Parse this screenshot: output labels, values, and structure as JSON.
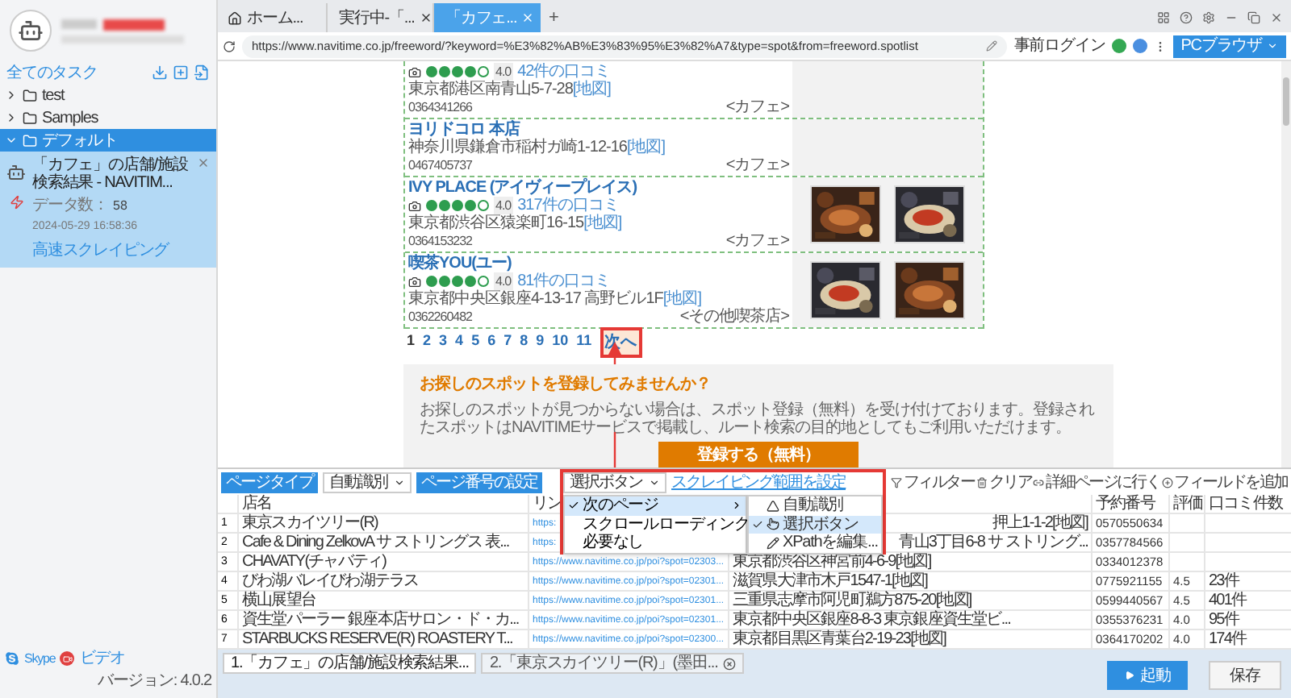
{
  "sidebar": {
    "title": "全てのタスク",
    "folders": [
      {
        "name": "test",
        "expanded": false,
        "selected": false
      },
      {
        "name": "Samples",
        "expanded": false,
        "selected": false
      },
      {
        "name": "デフォルト",
        "expanded": true,
        "selected": true,
        "tasks": [
          {
            "title": "「カフェ」の店舗/施設検索結果 - NAVITIM...",
            "data_label": "データ数：",
            "data_count": "58",
            "timestamp": "2024-05-29 16:58:36",
            "mode": "高速スクレイピング",
            "selected": true
          }
        ]
      }
    ],
    "footer": {
      "skype": "Skype",
      "video": "ビデオ",
      "version": "バージョン: 4.0.2"
    }
  },
  "browser": {
    "tabs": [
      {
        "label": "ホーム...",
        "kind": "home",
        "selected": false
      },
      {
        "label": "実行中-「...",
        "kind": "page",
        "selected": false
      },
      {
        "label": "「カフェ...",
        "kind": "page",
        "selected": true
      }
    ],
    "new_tab": "+",
    "url": "https://www.navitime.co.jp/freeword/?keyword=%E3%82%AB%E3%83%95%E3%82%A7&type=spot&from=freeword.spotlist",
    "login": "事前ログイン",
    "mode": "PCブラウザ"
  },
  "page": {
    "results": [
      {
        "stars": 4,
        "score": "4.0",
        "reviews": "42件の口コミ",
        "address": "東京都港区南青山5-7-28",
        "map": "[地図]",
        "phone": "0364341266",
        "category": "<カフェ>"
      },
      {
        "name": "ヨリドコロ 本店",
        "address": "神奈川県鎌倉市稲村ガ崎1-12-16",
        "map": "[地図]",
        "phone": "0467405737",
        "category": "<カフェ>"
      },
      {
        "name": "IVY PLACE (アイヴィープレイス)",
        "stars": 4,
        "score": "4.0",
        "reviews": "317件の口コミ",
        "address": "東京都渋谷区猿楽町16-15",
        "map": "[地図]",
        "phone": "0364153232",
        "category": "<カフェ>",
        "photos": [
          {
            "kind": "picture"
          },
          {
            "kind": "picture"
          }
        ]
      },
      {
        "name": "喫茶YOU(ユー)",
        "stars": 4,
        "score": "4.0",
        "reviews": "81件の口コミ",
        "address": "東京都中央区銀座4-13-17 高野ビル1F",
        "map": "[地図]",
        "phone": "0362260482",
        "category": "<その他喫茶店>",
        "photos": [
          {
            "kind": "picture"
          },
          {
            "kind": "picture"
          }
        ]
      }
    ],
    "pagination": {
      "pages": [
        "1",
        "2",
        "3",
        "4",
        "5",
        "6",
        "7",
        "8",
        "9",
        "10",
        "11"
      ],
      "next": "次へ"
    },
    "register": {
      "title": "お探しのスポットを登録してみませんか？",
      "body": "お探しのスポットが見つからない場合は、スポット登録（無料）を受け付けております。登録されたスポットはNAVITIMEサービスで掲載し、ルート検索の目的地としてもご利用いただけます。",
      "button": "登録する（無料）"
    }
  },
  "scraper": {
    "toolbar": {
      "page_type_label": "ページタイプ",
      "page_type_value": "自動識別",
      "pager_label": "ページ番号の設定",
      "pager_value": "選択ボタン",
      "range_link": "スクレイピング範囲を設定",
      "filter": "フィルター",
      "clear": "クリア",
      "detail": "詳細ページに行く",
      "add_field": "フィールドを追加"
    },
    "menu": {
      "items": [
        {
          "label": "次のページ",
          "checked": true,
          "selected": true,
          "submenu": [
            {
              "label": "自動識別",
              "kind": "auto",
              "checked": false,
              "selected": false
            },
            {
              "label": "選択ボタン",
              "kind": "click",
              "checked": true,
              "selected": true
            },
            {
              "label": "XPathを編集...",
              "kind": "xpath",
              "checked": false,
              "selected": false
            }
          ]
        },
        {
          "label": "スクロールローディング",
          "checked": false,
          "selected": false
        },
        {
          "label": "必要なし",
          "checked": false,
          "selected": false
        }
      ]
    },
    "table": {
      "columns": [
        {
          "kind": "text",
          "label": "店名"
        },
        {
          "kind": "text",
          "label": "リン"
        },
        {
          "kind": "hidden"
        },
        {
          "kind": "text",
          "label": "予約番号"
        },
        {
          "kind": "text",
          "label": "評価"
        },
        {
          "kind": "text",
          "label": "口コミ件数"
        }
      ],
      "rows": [
        {
          "index": "1",
          "covered": true,
          "cells": [
            "東京スカイツリー(R)",
            "https:",
            "押上1-1-2[地図]",
            "0570550634",
            null,
            null
          ]
        },
        {
          "index": "2",
          "covered": true,
          "cells": [
            "Cafe & Dining ZelkovA サ ストリングス 表...",
            "https:",
            "青山3丁目6-8 サ ストリング...",
            "0357784566",
            null,
            null
          ]
        },
        {
          "index": "3",
          "covered": false,
          "cells": [
            "CHAVATY(チャバティ)",
            "https://www.navitime.co.jp/poi?spot=02303...",
            "東京都渋谷区神宮前4-6-9[地図]",
            "0334012378",
            null,
            null
          ]
        },
        {
          "index": "4",
          "covered": false,
          "cells": [
            "びわ湖バレイびわ湖テラス",
            "https://www.navitime.co.jp/poi?spot=02301...",
            "滋賀県大津市木戸1547-1[地図]",
            "0775921155",
            "4.5",
            "23件"
          ]
        },
        {
          "index": "5",
          "covered": false,
          "cells": [
            "横山展望台",
            "https://www.navitime.co.jp/poi?spot=02301...",
            "三重県志摩市阿児町鵜方875-20[地図]",
            "0599440567",
            "4.5",
            "401件"
          ]
        },
        {
          "index": "6",
          "covered": false,
          "cells": [
            "資生堂パーラー 銀座本店サロン・ド・カ...",
            "https://www.navitime.co.jp/poi?spot=02301...",
            "東京都中央区銀座8-8-3 東京銀座資生堂ビ...",
            "0355376231",
            "4.0",
            "95件"
          ]
        },
        {
          "index": "7",
          "covered": false,
          "cells": [
            "STARBUCKS RESERVE(R) ROASTERY T...",
            "https://www.navitime.co.jp/poi?spot=02300...",
            "東京都目黒区青葉台2-19-23[地図]",
            "0364170202",
            "4.0",
            "174件"
          ]
        }
      ]
    }
  },
  "task_tabs": [
    {
      "label": "1.「カフェ」の店舗/施設検索結果...",
      "selected": true,
      "closable": false
    },
    {
      "label": "2.「東京スカイツリー(R)」(墨田...",
      "selected": false,
      "closable": true
    }
  ],
  "actions": {
    "start": "起動",
    "save": "保存"
  }
}
